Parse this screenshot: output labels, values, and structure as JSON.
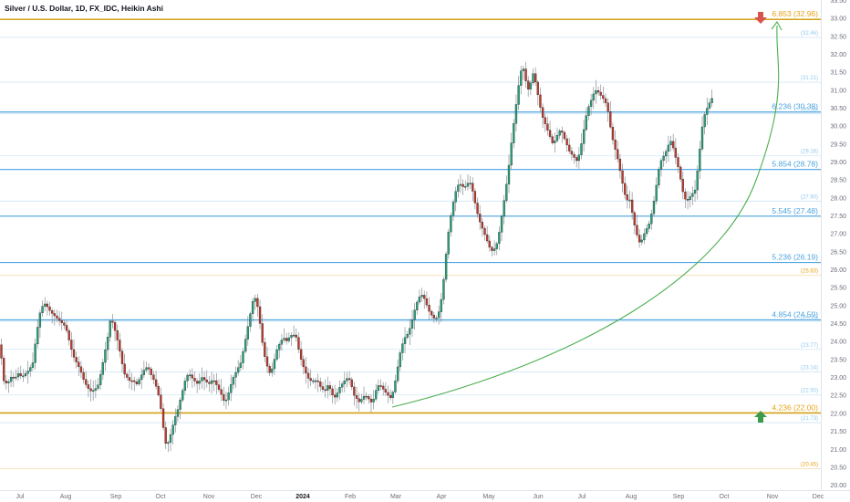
{
  "header": {
    "title": "Silver / U.S. Dollar, 1D, FX_IDC, Heikin Ashi"
  },
  "colors": {
    "up": "#26a17b",
    "down": "#c0392b",
    "wick": "#8a8f98",
    "fib_blue": "#4aa3df",
    "fib_light": "#8fc9ec",
    "fib_orange": "#e8a317",
    "gold_line": "#d4a017",
    "curve": "#4caf50",
    "text": "#131722",
    "axis_text": "#6a6d78",
    "arrow_down": "#d9534f",
    "arrow_up": "#3c9a4c"
  },
  "chart_data": {
    "type": "candlestick",
    "chart_style": "Heikin Ashi",
    "y_axis": {
      "min": 19.85,
      "max": 33.5,
      "position": "right",
      "ticks": [
        "20.00",
        "20.50",
        "21.00",
        "21.50",
        "22.00",
        "22.50",
        "23.00",
        "23.50",
        "24.00",
        "24.50",
        "25.00",
        "25.50",
        "26.00",
        "26.50",
        "27.00",
        "27.50",
        "28.00",
        "28.50",
        "29.00",
        "29.50",
        "30.00",
        "30.50",
        "31.00",
        "31.50",
        "32.00",
        "32.50",
        "33.00",
        "33.50"
      ]
    },
    "x_axis": {
      "labels": [
        "Jul",
        "Aug",
        "Sep",
        "Oct",
        "Nov",
        "Dec",
        "2024",
        "Feb",
        "Mar",
        "Apr",
        "May",
        "Jun",
        "Jul",
        "Aug",
        "Sep",
        "Oct",
        "Nov",
        "Dec"
      ],
      "bold": [
        "2024"
      ]
    },
    "fib_levels": [
      {
        "label": "6.853 (32.96)",
        "price": 32.96,
        "style": "gold"
      },
      {
        "label": "(32.46)",
        "price": 32.46,
        "style": "light"
      },
      {
        "label": "(31.21)",
        "price": 31.21,
        "style": "light"
      },
      {
        "label": "6.236 (30.38)",
        "price": 30.38,
        "style": "blue"
      },
      {
        "label": "(30.38)",
        "price": 30.33,
        "style": "light"
      },
      {
        "label": "(29.16)",
        "price": 29.16,
        "style": "light"
      },
      {
        "label": "5.854 (28.78)",
        "price": 28.78,
        "style": "blue"
      },
      {
        "label": "(27.90)",
        "price": 27.9,
        "style": "light"
      },
      {
        "label": "5.545 (27.48)",
        "price": 27.48,
        "style": "blue"
      },
      {
        "label": "5.236 (26.19)",
        "price": 26.19,
        "style": "blue"
      },
      {
        "label": "(25.83)",
        "price": 25.83,
        "style": "orange"
      },
      {
        "label": "4.854 (24.59)",
        "price": 24.59,
        "style": "blue"
      },
      {
        "label": "(24.55)",
        "price": 24.55,
        "style": "light"
      },
      {
        "label": "(23.77)",
        "price": 23.77,
        "style": "light"
      },
      {
        "label": "(23.14)",
        "price": 23.14,
        "style": "light"
      },
      {
        "label": "(22.50)",
        "price": 22.5,
        "style": "light"
      },
      {
        "label": "4.236 (22.00)",
        "price": 22.0,
        "style": "gold"
      },
      {
        "label": "(21.73)",
        "price": 21.73,
        "style": "light"
      },
      {
        "label": "(20.45)",
        "price": 20.45,
        "style": "orange"
      }
    ],
    "price_path": [
      [
        0,
        23.9
      ],
      [
        4,
        22.9
      ],
      [
        8,
        22.8
      ],
      [
        12,
        23.0
      ],
      [
        16,
        22.95
      ],
      [
        20,
        23.1
      ],
      [
        24,
        23.0
      ],
      [
        28,
        23.1
      ],
      [
        32,
        23.2
      ],
      [
        36,
        23.4
      ],
      [
        40,
        24.2
      ],
      [
        44,
        24.8
      ],
      [
        47,
        25.0
      ],
      [
        50,
        25.05
      ],
      [
        53,
        24.9
      ],
      [
        56,
        24.8
      ],
      [
        60,
        24.7
      ],
      [
        64,
        24.6
      ],
      [
        68,
        24.5
      ],
      [
        72,
        24.4
      ],
      [
        74,
        24.2
      ],
      [
        77,
        23.9
      ],
      [
        80,
        23.6
      ],
      [
        84,
        23.4
      ],
      [
        88,
        23.2
      ],
      [
        92,
        22.9
      ],
      [
        96,
        22.7
      ],
      [
        100,
        22.6
      ],
      [
        104,
        22.65
      ],
      [
        108,
        22.8
      ],
      [
        112,
        23.3
      ],
      [
        115,
        23.7
      ],
      [
        118,
        24.1
      ],
      [
        121,
        24.6
      ],
      [
        124,
        24.5
      ],
      [
        127,
        24.2
      ],
      [
        130,
        23.9
      ],
      [
        133,
        23.5
      ],
      [
        136,
        23.1
      ],
      [
        139,
        23.0
      ],
      [
        142,
        22.9
      ],
      [
        146,
        22.9
      ],
      [
        150,
        22.8
      ],
      [
        154,
        23.0
      ],
      [
        158,
        23.2
      ],
      [
        162,
        23.3
      ],
      [
        165,
        23.1
      ],
      [
        169,
        22.9
      ],
      [
        173,
        22.6
      ],
      [
        176,
        22.2
      ],
      [
        179,
        21.6
      ],
      [
        182,
        21.1
      ],
      [
        185,
        21.2
      ],
      [
        188,
        21.5
      ],
      [
        191,
        21.8
      ],
      [
        195,
        22.1
      ],
      [
        198,
        22.4
      ],
      [
        201,
        22.7
      ],
      [
        204,
        23.0
      ],
      [
        207,
        23.1
      ],
      [
        210,
        23.0
      ],
      [
        213,
        22.9
      ],
      [
        217,
        22.8
      ],
      [
        221,
        23.0
      ],
      [
        225,
        22.9
      ],
      [
        229,
        22.8
      ],
      [
        232,
        22.9
      ],
      [
        235,
        22.9
      ],
      [
        239,
        22.7
      ],
      [
        243,
        22.5
      ],
      [
        246,
        22.3
      ],
      [
        249,
        22.4
      ],
      [
        252,
        22.7
      ],
      [
        256,
        23.0
      ],
      [
        260,
        23.2
      ],
      [
        264,
        23.4
      ],
      [
        268,
        23.9
      ],
      [
        271,
        24.3
      ],
      [
        274,
        24.7
      ],
      [
        277,
        25.1
      ],
      [
        280,
        25.2
      ],
      [
        283,
        24.9
      ],
      [
        286,
        24.3
      ],
      [
        289,
        23.7
      ],
      [
        292,
        23.4
      ],
      [
        295,
        23.1
      ],
      [
        298,
        23.2
      ],
      [
        301,
        23.5
      ],
      [
        304,
        23.8
      ],
      [
        308,
        24.0
      ],
      [
        311,
        24.1
      ],
      [
        314,
        24.0
      ],
      [
        317,
        24.1
      ],
      [
        321,
        24.2
      ],
      [
        325,
        24.1
      ],
      [
        328,
        23.7
      ],
      [
        331,
        23.4
      ],
      [
        334,
        23.2
      ],
      [
        337,
        23.0
      ],
      [
        340,
        22.9
      ],
      [
        344,
        22.9
      ],
      [
        348,
        22.9
      ],
      [
        352,
        22.7
      ],
      [
        356,
        22.6
      ],
      [
        360,
        22.8
      ],
      [
        363,
        22.6
      ],
      [
        366,
        22.4
      ],
      [
        369,
        22.5
      ],
      [
        372,
        22.7
      ],
      [
        375,
        22.8
      ],
      [
        378,
        22.9
      ],
      [
        382,
        23.0
      ],
      [
        385,
        22.8
      ],
      [
        388,
        22.5
      ],
      [
        391,
        22.4
      ],
      [
        394,
        22.3
      ],
      [
        397,
        22.4
      ],
      [
        400,
        22.5
      ],
      [
        404,
        22.4
      ],
      [
        407,
        22.3
      ],
      [
        410,
        22.4
      ],
      [
        413,
        22.7
      ],
      [
        416,
        22.8
      ],
      [
        419,
        22.7
      ],
      [
        422,
        22.6
      ],
      [
        425,
        22.5
      ],
      [
        429,
        22.4
      ],
      [
        432,
        22.7
      ],
      [
        435,
        23.1
      ],
      [
        438,
        23.6
      ],
      [
        441,
        23.9
      ],
      [
        444,
        24.1
      ],
      [
        447,
        24.2
      ],
      [
        450,
        24.4
      ],
      [
        453,
        24.7
      ],
      [
        456,
        25.0
      ],
      [
        459,
        25.2
      ],
      [
        462,
        25.3
      ],
      [
        465,
        25.2
      ],
      [
        468,
        25.0
      ],
      [
        471,
        24.8
      ],
      [
        474,
        24.7
      ],
      [
        477,
        24.6
      ],
      [
        480,
        24.7
      ],
      [
        483,
        25.0
      ],
      [
        486,
        25.6
      ],
      [
        489,
        26.4
      ],
      [
        492,
        27.1
      ],
      [
        495,
        27.6
      ],
      [
        498,
        28.0
      ],
      [
        501,
        28.3
      ],
      [
        504,
        28.4
      ],
      [
        507,
        28.3
      ],
      [
        510,
        28.3
      ],
      [
        513,
        28.4
      ],
      [
        516,
        28.4
      ],
      [
        519,
        28.1
      ],
      [
        522,
        27.7
      ],
      [
        525,
        27.4
      ],
      [
        528,
        27.2
      ],
      [
        531,
        27.0
      ],
      [
        534,
        26.8
      ],
      [
        537,
        26.6
      ],
      [
        540,
        26.5
      ],
      [
        543,
        26.6
      ],
      [
        546,
        26.8
      ],
      [
        549,
        27.3
      ],
      [
        552,
        27.8
      ],
      [
        555,
        28.3
      ],
      [
        558,
        28.9
      ],
      [
        561,
        29.6
      ],
      [
        564,
        30.2
      ],
      [
        567,
        30.8
      ],
      [
        570,
        31.4
      ],
      [
        573,
        31.7
      ],
      [
        576,
        31.3
      ],
      [
        579,
        31.0
      ],
      [
        582,
        31.2
      ],
      [
        585,
        31.5
      ],
      [
        588,
        31.1
      ],
      [
        591,
        30.7
      ],
      [
        594,
        30.3
      ],
      [
        597,
        30.1
      ],
      [
        600,
        29.9
      ],
      [
        603,
        29.7
      ],
      [
        606,
        29.5
      ],
      [
        609,
        29.6
      ],
      [
        612,
        29.8
      ],
      [
        615,
        29.9
      ],
      [
        618,
        29.7
      ],
      [
        621,
        29.5
      ],
      [
        624,
        29.3
      ],
      [
        627,
        29.2
      ],
      [
        630,
        29.1
      ],
      [
        633,
        29.0
      ],
      [
        636,
        29.3
      ],
      [
        639,
        29.7
      ],
      [
        642,
        30.2
      ],
      [
        645,
        30.5
      ],
      [
        648,
        30.7
      ],
      [
        651,
        30.9
      ],
      [
        654,
        31.0
      ],
      [
        657,
        30.9
      ],
      [
        660,
        30.8
      ],
      [
        663,
        30.7
      ],
      [
        666,
        30.5
      ],
      [
        669,
        30.0
      ],
      [
        672,
        29.6
      ],
      [
        675,
        29.3
      ],
      [
        678,
        29.0
      ],
      [
        681,
        28.6
      ],
      [
        684,
        28.2
      ],
      [
        687,
        27.9
      ],
      [
        690,
        28.0
      ],
      [
        693,
        27.6
      ],
      [
        696,
        27.2
      ],
      [
        699,
        26.9
      ],
      [
        702,
        26.7
      ],
      [
        705,
        26.9
      ],
      [
        708,
        27.1
      ],
      [
        711,
        27.2
      ],
      [
        714,
        27.5
      ],
      [
        717,
        27.9
      ],
      [
        720,
        28.4
      ],
      [
        723,
        28.9
      ],
      [
        726,
        29.1
      ],
      [
        729,
        29.2
      ],
      [
        732,
        29.4
      ],
      [
        735,
        29.6
      ],
      [
        738,
        29.4
      ],
      [
        741,
        29.1
      ],
      [
        744,
        28.8
      ],
      [
        747,
        28.4
      ],
      [
        750,
        28.0
      ],
      [
        753,
        27.9
      ],
      [
        756,
        28.0
      ],
      [
        759,
        28.1
      ],
      [
        762,
        28.2
      ],
      [
        765,
        28.8
      ],
      [
        768,
        29.5
      ],
      [
        771,
        30.2
      ],
      [
        774,
        30.4
      ],
      [
        777,
        30.6
      ],
      [
        780,
        30.7
      ],
      [
        783,
        31.0
      ]
    ]
  }
}
